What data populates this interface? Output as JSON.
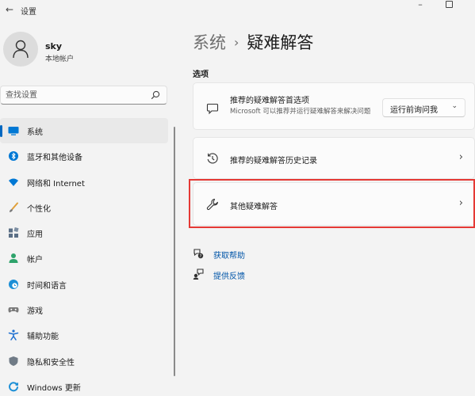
{
  "window": {
    "title": "设置",
    "back_icon": "back-arrow-icon"
  },
  "profile": {
    "name": "sky",
    "account_type": "本地帐户"
  },
  "search": {
    "placeholder": "查找设置"
  },
  "sidebar": {
    "items": [
      {
        "label": "系统",
        "icon": "monitor-icon",
        "color": "#0078d4",
        "active": true
      },
      {
        "label": "蓝牙和其他设备",
        "icon": "bluetooth-icon",
        "color": "#0078d4"
      },
      {
        "label": "网络和 Internet",
        "icon": "wifi-icon",
        "color": "#0078d4"
      },
      {
        "label": "个性化",
        "icon": "brush-icon",
        "color": "#e0a03a"
      },
      {
        "label": "应用",
        "icon": "apps-icon",
        "color": "#5b6f86"
      },
      {
        "label": "帐户",
        "icon": "person-icon",
        "color": "#2ea36b"
      },
      {
        "label": "时间和语言",
        "icon": "globe-clock-icon",
        "color": "#1c8fd6"
      },
      {
        "label": "游戏",
        "icon": "gamepad-icon",
        "color": "#7a7a7a"
      },
      {
        "label": "辅助功能",
        "icon": "accessibility-icon",
        "color": "#1d6fd1"
      },
      {
        "label": "隐私和安全性",
        "icon": "shield-icon",
        "color": "#707b86"
      },
      {
        "label": "Windows 更新",
        "icon": "update-icon",
        "color": "#1c8fd6"
      }
    ]
  },
  "breadcrumb": {
    "parent": "系统",
    "separator": "›",
    "current": "疑难解答"
  },
  "section": {
    "label": "选项"
  },
  "cards": [
    {
      "title": "推荐的疑难解答首选项",
      "description": "Microsoft 可以推荐并运行疑难解答来解决问题",
      "icon": "chat-bubble-icon",
      "dropdown_value": "运行前询问我"
    },
    {
      "title": "推荐的疑难解答历史记录",
      "icon": "history-icon"
    },
    {
      "title": "其他疑难解答",
      "icon": "wrench-icon",
      "highlighted": true
    }
  ],
  "links": [
    {
      "label": "获取帮助",
      "icon": "help-icon"
    },
    {
      "label": "提供反馈",
      "icon": "feedback-icon"
    }
  ],
  "colors": {
    "accent": "#0067c0",
    "highlight_border": "#e53935",
    "link": "#0055a8"
  }
}
